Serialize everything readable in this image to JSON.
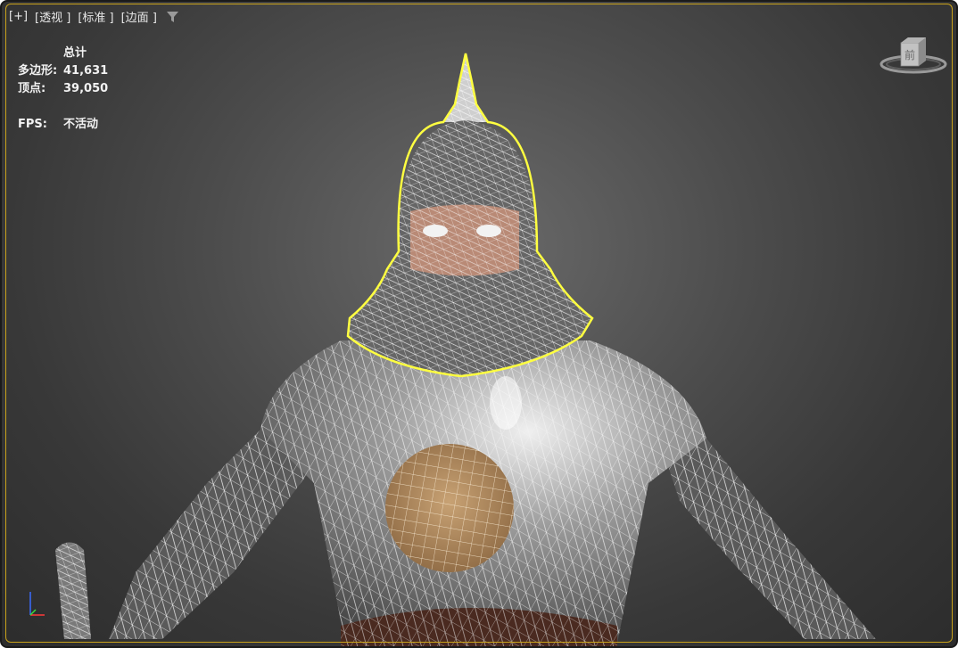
{
  "viewport": {
    "labels": [
      "[+]",
      "[透视 ]",
      "[标准 ]",
      "[边面 ]"
    ],
    "filter_icon": "funnel-icon"
  },
  "stats": {
    "title": "总计",
    "polygons_label": "多边形:",
    "polygons_value": "41,631",
    "vertices_label": "顶点:",
    "vertices_value": "39,050",
    "fps_label": "FPS:",
    "fps_value": "不活动"
  },
  "viewcube": {
    "face_label": "前",
    "icon": "viewcube-icon"
  },
  "colors": {
    "selection_highlight": "#ffff40",
    "viewport_border": "#c9a21a"
  }
}
